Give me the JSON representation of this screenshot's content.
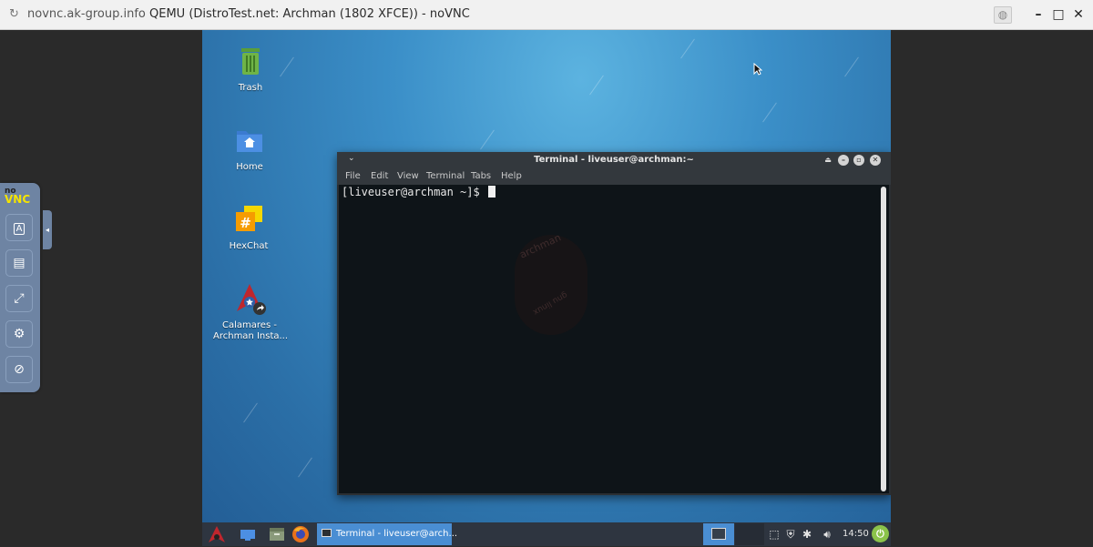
{
  "browser": {
    "host": "novnc.ak-group.info",
    "title": "QEMU (DistroTest.net: Archman (1802 XFCE)) - noVNC",
    "reload_icon": "reload-icon",
    "minimize_glyph": "–",
    "maximize_glyph": "□",
    "close_glyph": "✕"
  },
  "novnc": {
    "logo_no": "no",
    "logo_vnc": "VNC",
    "buttons": [
      {
        "name": "keyboard-button",
        "icon": "keyboard-icon",
        "glyph": "A"
      },
      {
        "name": "clipboard-button",
        "icon": "clipboard-icon",
        "glyph": "▤"
      },
      {
        "name": "fullscreen-button",
        "icon": "fullscreen-icon",
        "glyph": "⤢"
      },
      {
        "name": "settings-button",
        "icon": "gear-icon",
        "glyph": "⚙"
      },
      {
        "name": "disconnect-button",
        "icon": "disconnect-icon",
        "glyph": "⊘"
      }
    ],
    "handle_glyph": "◂"
  },
  "desktop": {
    "icons": [
      {
        "label": "Trash"
      },
      {
        "label": "Home"
      },
      {
        "label": "HexChat"
      },
      {
        "label": "Calamares -",
        "label2": "Archman Insta..."
      }
    ]
  },
  "terminal": {
    "title": "Terminal - liveuser@archman:~",
    "menu": [
      "File",
      "Edit",
      "View",
      "Terminal",
      "Tabs",
      "Help"
    ],
    "prompt": "[liveuser@archman ~]$ ",
    "watermark_top": "archman",
    "watermark_bottom": "gnu linux"
  },
  "taskbar": {
    "task_label": "Terminal - liveuser@arch...",
    "clock": "14:50",
    "colors": {
      "accent": "#4a8ed3",
      "power": "#8bc34a"
    }
  }
}
